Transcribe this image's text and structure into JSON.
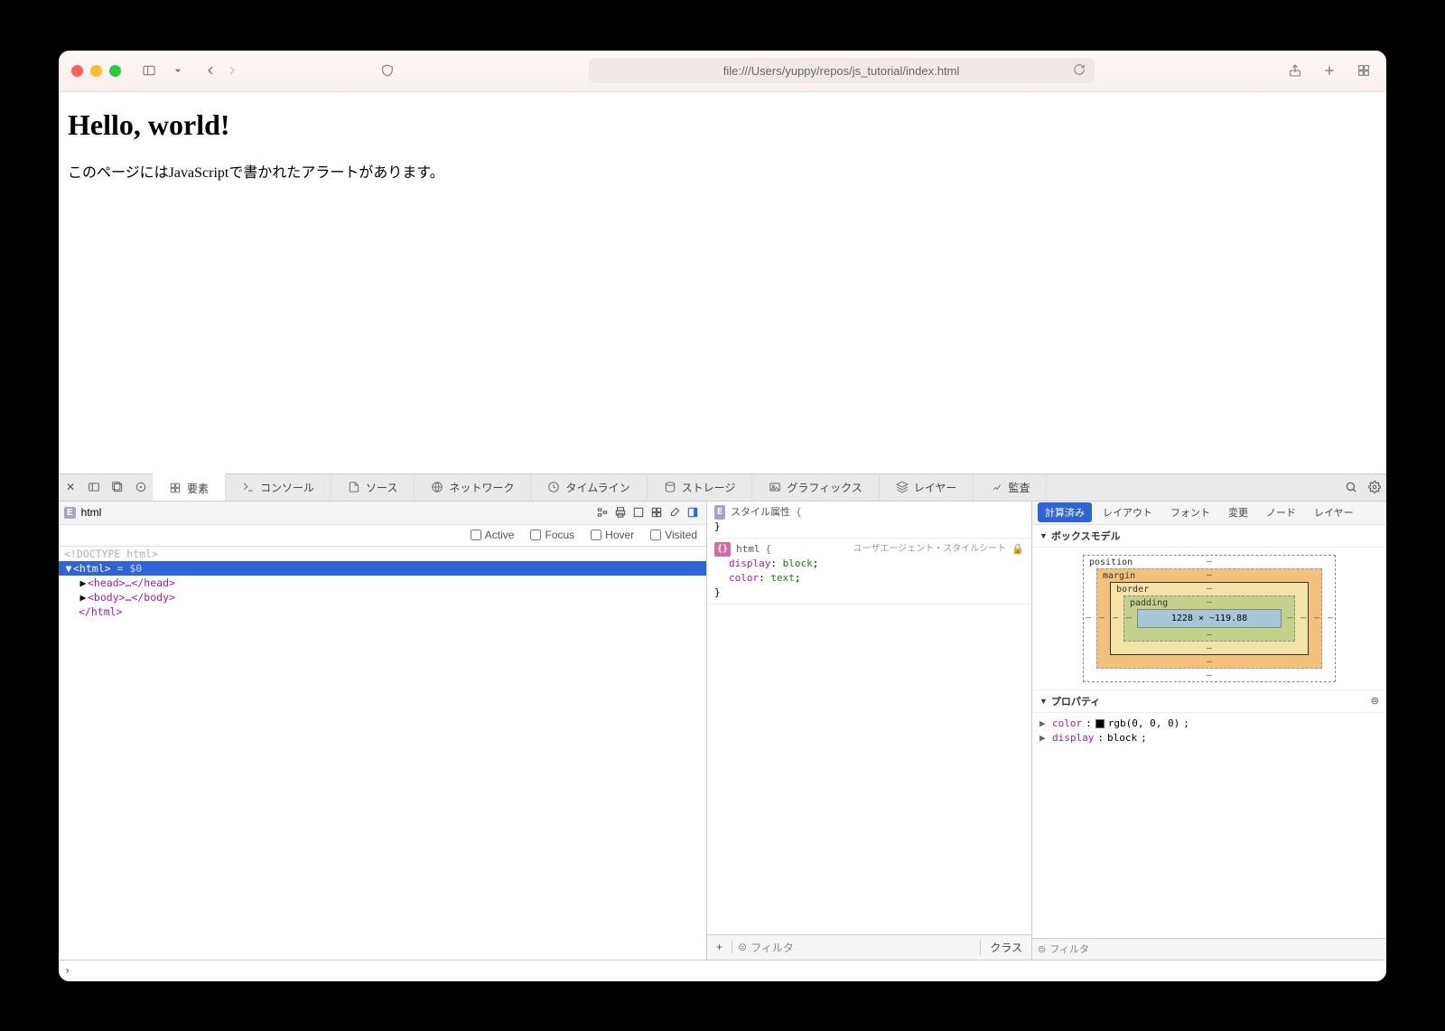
{
  "browser": {
    "url": "file:///Users/yuppy/repos/js_tutorial/index.html"
  },
  "page": {
    "heading": "Hello, world!",
    "paragraph": "このページにはJavaScriptで書かれたアラートがあります。"
  },
  "devtools": {
    "tabs": [
      "要素",
      "コンソール",
      "ソース",
      "ネットワーク",
      "タイムライン",
      "ストレージ",
      "グラフィックス",
      "レイヤー",
      "監査"
    ],
    "breadcrumb": "html",
    "force_states": [
      "Active",
      "Focus",
      "Hover",
      "Visited"
    ],
    "dom": {
      "doctype": "<!DOCTYPE html>",
      "html_open": "<html>",
      "html_var": "= $0",
      "head": "<head>…</head>",
      "body": "<body>…</body>",
      "html_close": "</html>"
    },
    "styles": {
      "attr_label": "スタイル属性",
      "html_selector": "html",
      "ua_label": "ユーザエージェント・スタイルシート",
      "props": [
        {
          "name": "display",
          "value": "block"
        },
        {
          "name": "color",
          "value": "text"
        }
      ],
      "filter_placeholder": "フィルタ",
      "class_btn": "クラス"
    },
    "right": {
      "tabs": [
        "計算済み",
        "レイアウト",
        "フォント",
        "変更",
        "ノード",
        "レイヤー"
      ],
      "boxmodel_title": "ボックスモデル",
      "labels": {
        "position": "position",
        "margin": "margin",
        "border": "border",
        "padding": "padding"
      },
      "content_dims": "1228 × ~119.88",
      "properties_title": "プロパティ",
      "properties": [
        {
          "name": "color",
          "value": "rgb(0, 0, 0)",
          "swatch": true
        },
        {
          "name": "display",
          "value": "block"
        }
      ],
      "filter_placeholder": "フィルタ"
    }
  }
}
